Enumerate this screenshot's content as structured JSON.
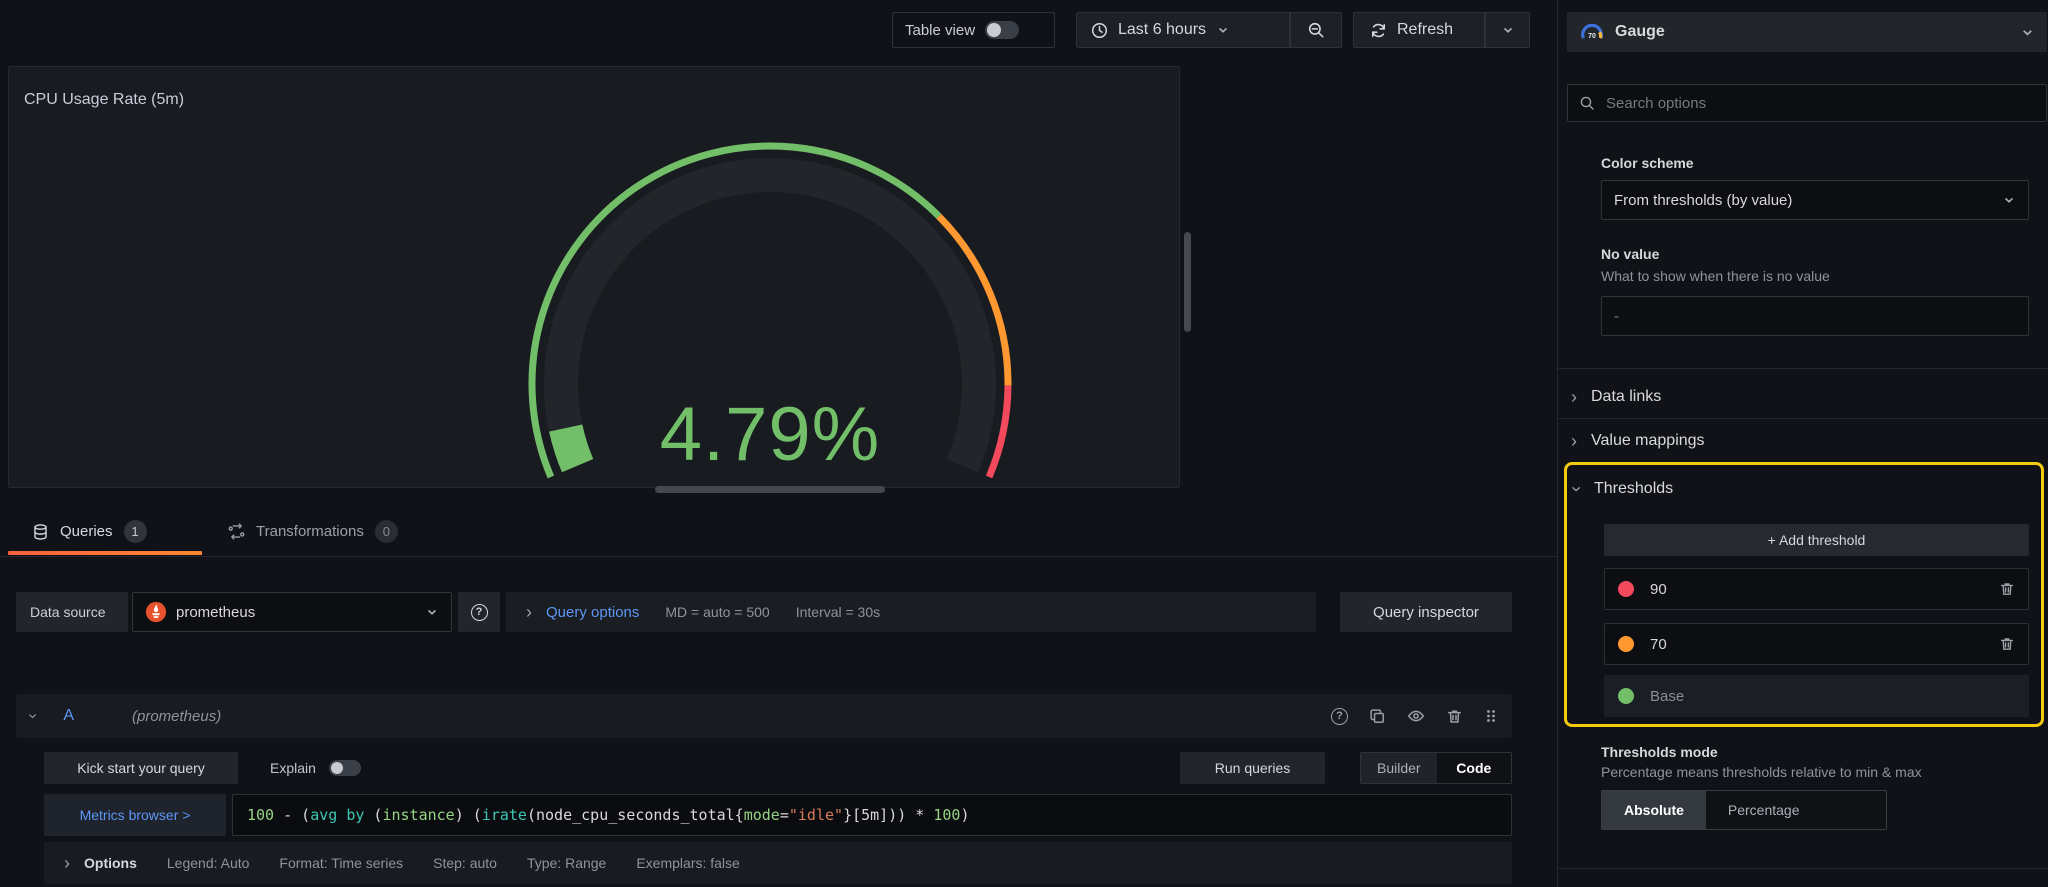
{
  "toolbar": {
    "table_view_label": "Table view",
    "time_range_label": "Last 6 hours",
    "refresh_label": "Refresh"
  },
  "panel": {
    "title": "CPU Usage Rate (5m)"
  },
  "chart_data": {
    "type": "gauge",
    "title": "CPU Usage Rate (5m)",
    "value": 4.79,
    "display_value": "4.79%",
    "min": 0,
    "max": 100,
    "unit": "percent",
    "start_angle_deg": 157,
    "sweep_deg": 226,
    "value_color": "#73bf69",
    "track_color": "#22262b",
    "thresholds": [
      {
        "label": "Base",
        "from": 0,
        "color": "#73bf69"
      },
      {
        "label": "70",
        "from": 70,
        "color": "#ff9830"
      },
      {
        "label": "90",
        "from": 90,
        "color": "#f2495c"
      }
    ]
  },
  "tabs": {
    "queries": {
      "label": "Queries",
      "badge": "1"
    },
    "transformations": {
      "label": "Transformations",
      "badge": "0"
    }
  },
  "query_editor": {
    "datasource_label": "Data source",
    "datasource_value": "prometheus",
    "query_options_label": "Query options",
    "summary_md": "MD = auto = 500",
    "summary_interval": "Interval = 30s",
    "query_inspector_label": "Query inspector",
    "row": {
      "ref_id": "A",
      "datasource_hint": "(prometheus)"
    },
    "kick_start_label": "Kick start your query",
    "explain_label": "Explain",
    "run_queries_label": "Run queries",
    "builder_label": "Builder",
    "code_label": "Code",
    "metrics_browser_label": "Metrics browser >",
    "expr_text": "100 - (avg by (instance) (irate(node_cpu_seconds_total{mode=\"idle\"}[5m])) * 100)",
    "expr_segments": [
      {
        "text": "100",
        "cls": "num"
      },
      {
        "text": " - (",
        "cls": "op"
      },
      {
        "text": "avg by",
        "cls": "kw"
      },
      {
        "text": " (",
        "cls": "op"
      },
      {
        "text": "instance",
        "cls": "attr"
      },
      {
        "text": ") (",
        "cls": "op"
      },
      {
        "text": "irate",
        "cls": "fn"
      },
      {
        "text": "(node_cpu_seconds_total{",
        "cls": "op"
      },
      {
        "text": "mode",
        "cls": "attr"
      },
      {
        "text": "=",
        "cls": "op"
      },
      {
        "text": "\"idle\"",
        "cls": "str"
      },
      {
        "text": "}[5m])) * ",
        "cls": "op"
      },
      {
        "text": "100",
        "cls": "num"
      },
      {
        "text": ")",
        "cls": "op"
      }
    ],
    "options_summary": {
      "label": "Options",
      "items": [
        "Legend: Auto",
        "Format: Time series",
        "Step: auto",
        "Type: Range",
        "Exemplars: false"
      ]
    }
  },
  "sidebar": {
    "viz_picker_label": "Gauge",
    "search_placeholder": "Search options",
    "color_scheme": {
      "label": "Color scheme",
      "value": "From thresholds (by value)"
    },
    "no_value": {
      "label": "No value",
      "description": "What to show when there is no value",
      "placeholder": "-"
    },
    "sections": {
      "data_links": "Data links",
      "value_mappings": "Value mappings",
      "thresholds": "Thresholds"
    },
    "thresholds": {
      "add_label": "+ Add threshold",
      "items": [
        {
          "value": "90",
          "color": "#f2495c",
          "deletable": true
        },
        {
          "value": "70",
          "color": "#ff9830",
          "deletable": true
        },
        {
          "value": "Base",
          "color": "#73bf69",
          "deletable": false
        }
      ],
      "mode": {
        "label": "Thresholds mode",
        "description": "Percentage means thresholds relative to min & max",
        "option_absolute": "Absolute",
        "option_percentage": "Percentage",
        "selected": "Absolute"
      }
    }
  },
  "colors": {
    "accent_blue": "#5d96f5",
    "green": "#73bf69",
    "orange": "#ff9830",
    "red": "#f2495c",
    "highlight_yellow": "#f2cc0c",
    "prometheus_orange": "#e6522c",
    "tab_underline": "linear-gradient(90deg,#f55f3e,#ff8833)"
  }
}
